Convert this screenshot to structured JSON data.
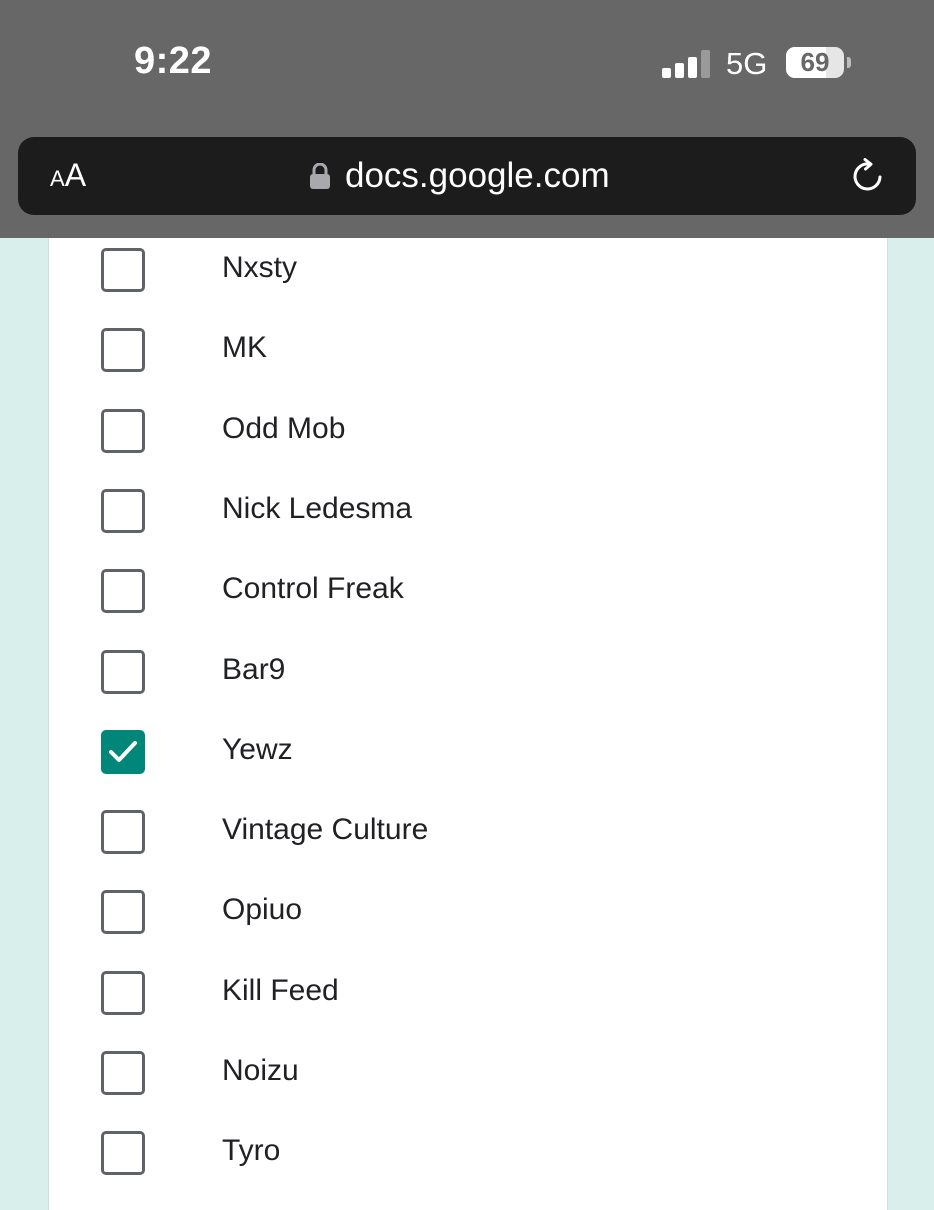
{
  "status_bar": {
    "time": "9:22",
    "network": "5G",
    "battery_percent": "69",
    "battery_level": 0.69,
    "signal_bars_active": 3,
    "signal_bars_total": 4
  },
  "browser": {
    "text_size_small": "A",
    "text_size_large": "A",
    "url": "docs.google.com",
    "lock_icon": "lock-icon",
    "reload_icon": "reload-icon"
  },
  "form": {
    "accent_color": "#01877a",
    "options": [
      {
        "label": "Nxsty",
        "checked": false
      },
      {
        "label": "MK",
        "checked": false
      },
      {
        "label": "Odd Mob",
        "checked": false
      },
      {
        "label": "Nick Ledesma",
        "checked": false
      },
      {
        "label": "Control Freak",
        "checked": false
      },
      {
        "label": "Bar9",
        "checked": false
      },
      {
        "label": "Yewz",
        "checked": true
      },
      {
        "label": "Vintage Culture",
        "checked": false
      },
      {
        "label": "Opiuo",
        "checked": false
      },
      {
        "label": "Kill Feed",
        "checked": false
      },
      {
        "label": "Noizu",
        "checked": false
      },
      {
        "label": "Tyro",
        "checked": false
      }
    ]
  }
}
